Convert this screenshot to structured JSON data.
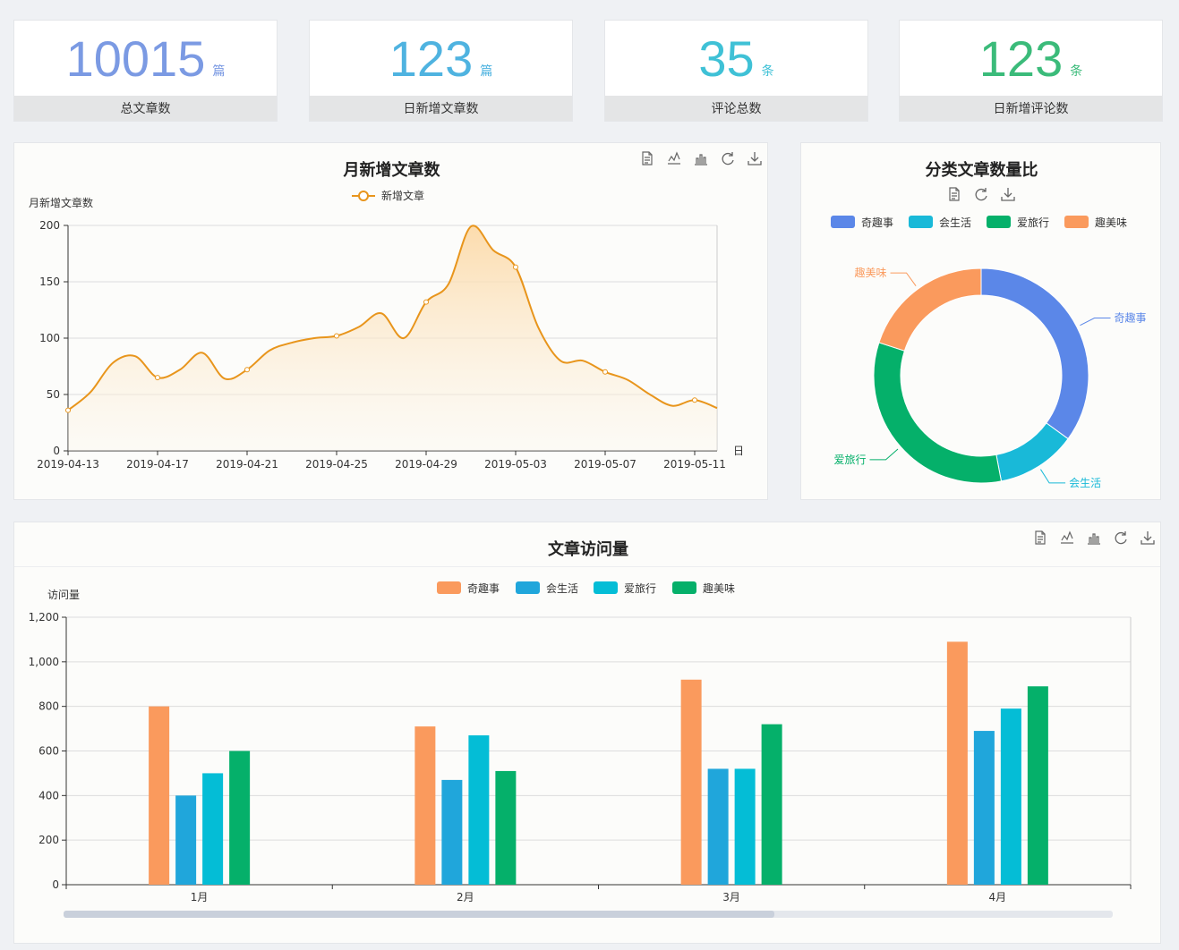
{
  "stats": [
    {
      "value": "10015",
      "unit": "篇",
      "label": "总文章数",
      "color": "#7b9ae3"
    },
    {
      "value": "123",
      "unit": "篇",
      "label": "日新增文章数",
      "color": "#4fb3e0"
    },
    {
      "value": "35",
      "unit": "条",
      "label": "评论总数",
      "color": "#3fc1d6"
    },
    {
      "value": "123",
      "unit": "条",
      "label": "日新增评论数",
      "color": "#3bbb7a"
    }
  ],
  "icons": [
    "data-view-icon",
    "line-chart-icon",
    "bar-chart-icon",
    "restore-icon",
    "download-icon"
  ],
  "chart_data": [
    {
      "type": "line",
      "title": "月新增文章数",
      "ylabel": "月新增文章数",
      "xlabel": "日",
      "legend": "新增文章",
      "color": "#e8951c",
      "area": true,
      "smooth": true,
      "ylim": [
        0,
        200
      ],
      "yticks": [
        "0",
        "50",
        "100",
        "150",
        "200"
      ],
      "x_ticks": [
        "2019-04-13",
        "2019-04-17",
        "2019-04-21",
        "2019-04-25",
        "2019-04-29",
        "2019-05-03",
        "2019-05-07",
        "2019-05-11"
      ],
      "x": [
        "2019-04-13",
        "2019-04-14",
        "2019-04-15",
        "2019-04-16",
        "2019-04-17",
        "2019-04-18",
        "2019-04-19",
        "2019-04-20",
        "2019-04-21",
        "2019-04-22",
        "2019-04-23",
        "2019-04-24",
        "2019-04-25",
        "2019-04-26",
        "2019-04-27",
        "2019-04-28",
        "2019-04-29",
        "2019-04-30",
        "2019-05-01",
        "2019-05-02",
        "2019-05-03",
        "2019-05-04",
        "2019-05-05",
        "2019-05-06",
        "2019-05-07",
        "2019-05-08",
        "2019-05-09",
        "2019-05-10",
        "2019-05-11",
        "2019-05-12"
      ],
      "values": [
        36,
        52,
        78,
        84,
        65,
        72,
        87,
        64,
        72,
        89,
        96,
        100,
        102,
        110,
        122,
        100,
        132,
        148,
        199,
        178,
        163,
        110,
        80,
        80,
        70,
        63,
        50,
        40,
        45,
        38
      ]
    },
    {
      "type": "pie",
      "title": "分类文章数量比",
      "donut": true,
      "labels": [
        "奇趣事",
        "会生活",
        "爱旅行",
        "趣美味"
      ],
      "values": [
        35,
        12,
        33,
        20
      ],
      "colors": [
        "#5b87e8",
        "#19b9d8",
        "#05b06a",
        "#fa9a5d"
      ]
    },
    {
      "type": "bar",
      "title": "文章访问量",
      "ylabel": "访问量",
      "categories": [
        "1月",
        "2月",
        "3月",
        "4月"
      ],
      "ylim": [
        0,
        1200
      ],
      "yticks": [
        "0",
        "200",
        "400",
        "600",
        "800",
        "1,000",
        "1,200"
      ],
      "series": [
        {
          "name": "奇趣事",
          "color": "#fa9a5d",
          "values": [
            800,
            710,
            920,
            1090
          ]
        },
        {
          "name": "会生活",
          "color": "#20a6db",
          "values": [
            400,
            470,
            520,
            690
          ]
        },
        {
          "name": "爱旅行",
          "color": "#04bdd6",
          "values": [
            500,
            670,
            520,
            790
          ]
        },
        {
          "name": "趣美味",
          "color": "#05b06a",
          "values": [
            600,
            510,
            720,
            890
          ]
        }
      ]
    }
  ]
}
